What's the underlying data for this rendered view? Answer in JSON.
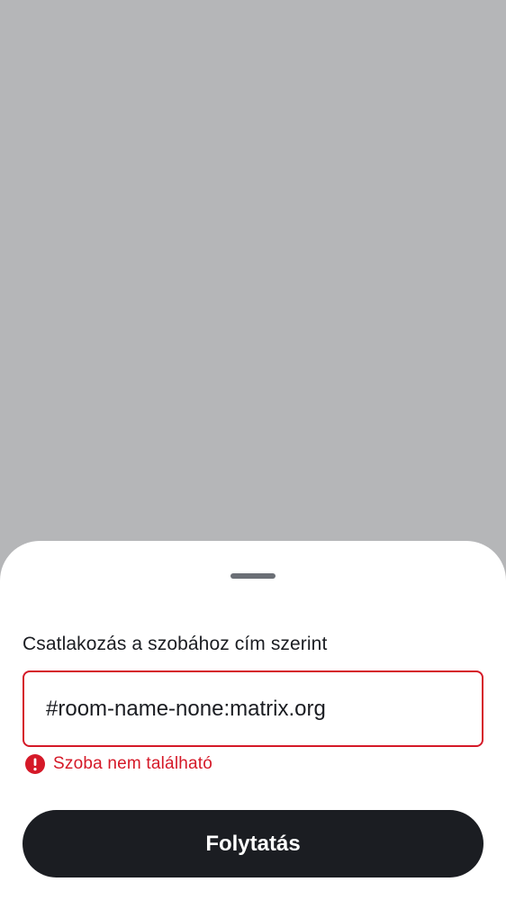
{
  "scrim": {
    "color": "#b5b6b8"
  },
  "sheet": {
    "label": "Csatlakozás a szobához cím szerint",
    "input": {
      "value": "#room-name-none:matrix.org",
      "placeholder": ""
    },
    "error": {
      "icon": "error-icon",
      "text": "Szoba nem található",
      "color": "#d51928"
    },
    "continue_label": "Folytatás"
  }
}
